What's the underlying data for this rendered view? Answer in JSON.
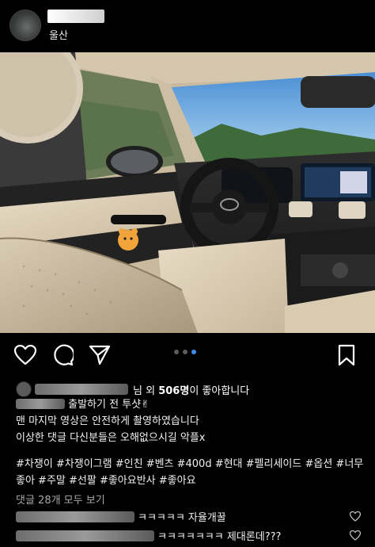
{
  "post": {
    "location": "울산"
  },
  "likes": {
    "suffix": "님 외",
    "count": "506명",
    "text_after": "이 좋아합니다"
  },
  "caption": {
    "line1": "출발하기 전 투샷✌",
    "line2": "맨 마지막 영상은 안전하게 촬영하였습니다",
    "line3": "이상한 댓글 다신분들은 오해없으시길 악플x"
  },
  "hashtags": "#차쟁이 #차쟁이그램 #인친 #벤츠 #400d #현대 #펠리세이드 #옵션 #너무좋아 #주말 #선팔 #좋아요반사 #좋아요",
  "comments": {
    "view_all": "댓글 28개 모두 보기",
    "items": [
      {
        "text": "ㅋㅋㅋㅋㅋ 자율개꿀"
      },
      {
        "text": "ㅋㅋㅋㅋㅋㅋㅋ 제대론데???"
      }
    ]
  },
  "carousel": {
    "count": 3,
    "active": 2
  },
  "icons": [
    "heart-icon",
    "comment-icon",
    "share-icon",
    "bookmark-icon"
  ]
}
